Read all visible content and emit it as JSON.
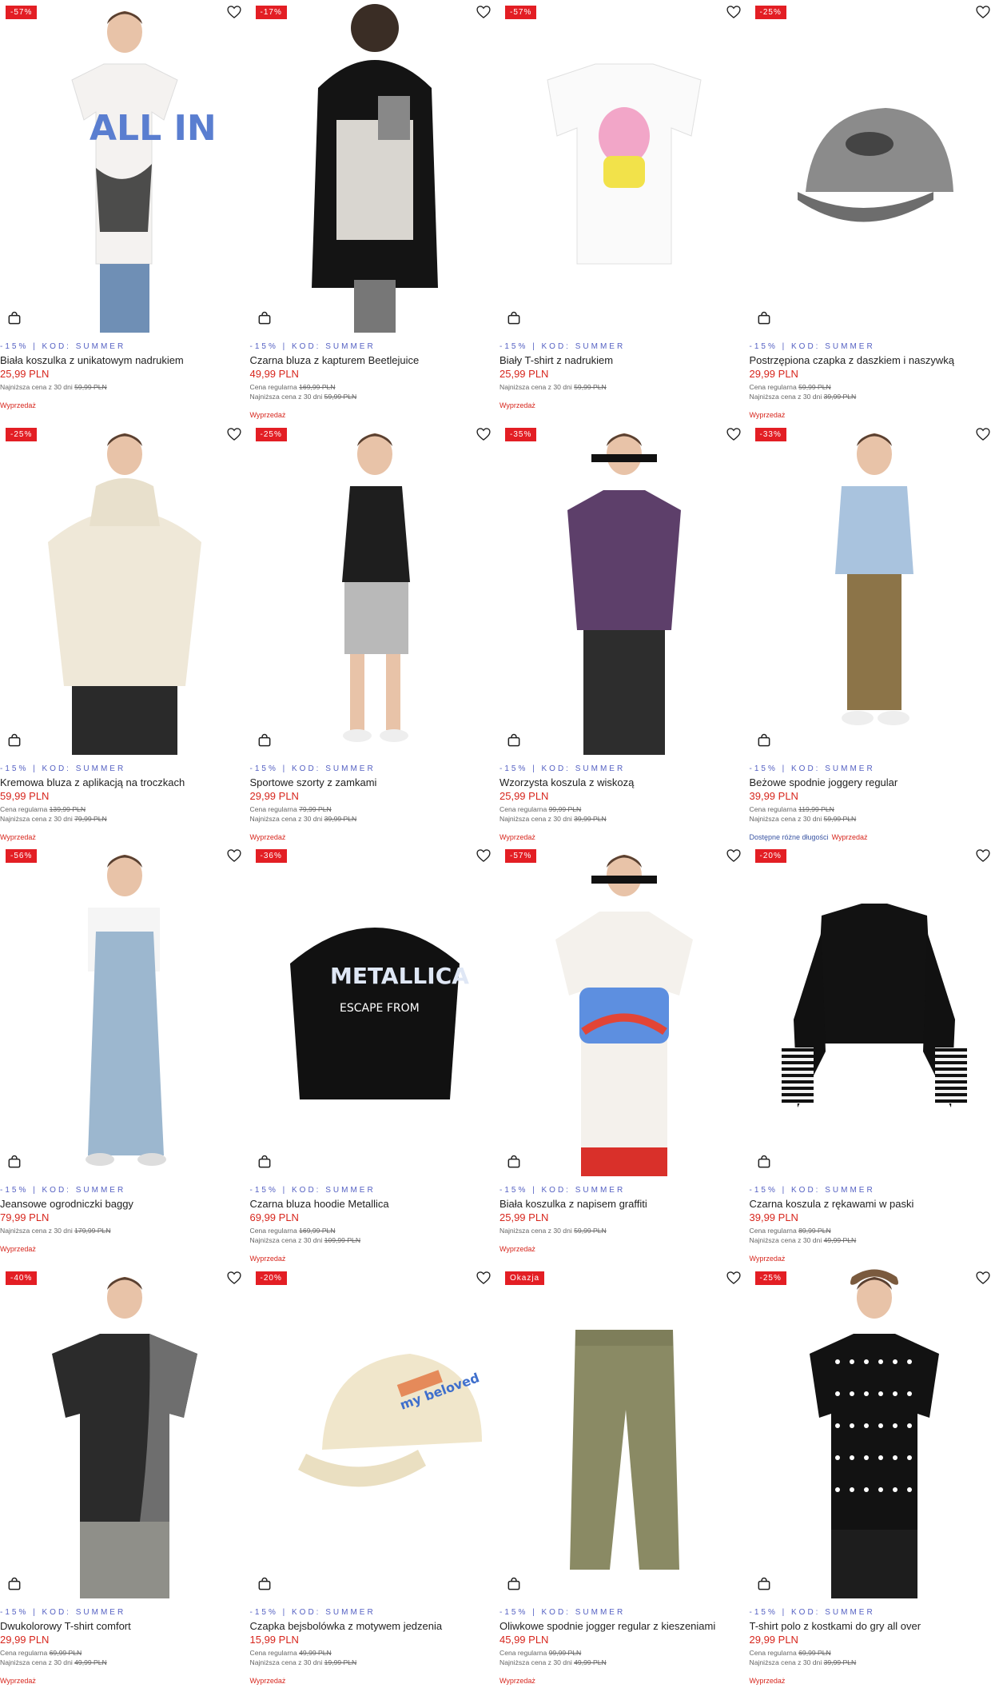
{
  "colors": {
    "badge": "#e31e24",
    "price": "#d7261d",
    "promo": "#5561c3"
  },
  "icons": {
    "wishlist": "heart-icon",
    "cart": "shopping-bag-icon"
  },
  "products": [
    {
      "badge": "-57%",
      "promo": "-15% | KOD: SUMMER",
      "name": "Biała koszulka z unikatowym nadrukiem",
      "price": "25,99 PLN",
      "regular_label": "",
      "regular_price": "",
      "lowest_label": "Najniższa cena z 30 dni",
      "lowest_price": "59,99 PLN",
      "flag": "Wyprzedaż",
      "sizes_note": "",
      "image": "white-oversized-tshirt"
    },
    {
      "badge": "-17%",
      "promo": "-15% | KOD: SUMMER",
      "name": "Czarna bluza z kapturem Beetlejuice",
      "price": "49,99 PLN",
      "regular_label": "Cena regularna",
      "regular_price": "169,99 PLN",
      "lowest_label": "Najniższa cena z 30 dni",
      "lowest_price": "59,99 PLN",
      "flag": "Wyprzedaż",
      "sizes_note": "",
      "image": "black-hoodie-back"
    },
    {
      "badge": "-57%",
      "promo": "-15% | KOD: SUMMER",
      "name": "Biały T-shirt z nadrukiem",
      "price": "25,99 PLN",
      "regular_label": "",
      "regular_price": "",
      "lowest_label": "Najniższa cena z 30 dni",
      "lowest_price": "59,99 PLN",
      "flag": "Wyprzedaż",
      "sizes_note": "",
      "image": "white-tshirt-flat"
    },
    {
      "badge": "-25%",
      "promo": "-15% | KOD: SUMMER",
      "name": "Postrzępiona czapka z daszkiem i naszywką",
      "price": "29,99 PLN",
      "regular_label": "Cena regularna",
      "regular_price": "59,99 PLN",
      "lowest_label": "Najniższa cena z 30 dni",
      "lowest_price": "39,99 PLN",
      "flag": "Wyprzedaż",
      "sizes_note": "",
      "image": "grey-cap"
    },
    {
      "badge": "-25%",
      "promo": "-15% | KOD: SUMMER",
      "name": "Kremowa bluza z aplikacją na troczkach",
      "price": "59,99 PLN",
      "regular_label": "Cena regularna",
      "regular_price": "139,99 PLN",
      "lowest_label": "Najniższa cena z 30 dni",
      "lowest_price": "79,99 PLN",
      "flag": "Wyprzedaż",
      "sizes_note": "",
      "image": "cream-hoodie"
    },
    {
      "badge": "-25%",
      "promo": "-15% | KOD: SUMMER",
      "name": "Sportowe szorty z zamkami",
      "price": "29,99 PLN",
      "regular_label": "Cena regularna",
      "regular_price": "79,99 PLN",
      "lowest_label": "Najniższa cena z 30 dni",
      "lowest_price": "39,99 PLN",
      "flag": "Wyprzedaż",
      "sizes_note": "",
      "image": "model-shorts"
    },
    {
      "badge": "-35%",
      "promo": "-15% | KOD: SUMMER",
      "name": "Wzorzysta koszula z wiskozą",
      "price": "25,99 PLN",
      "regular_label": "Cena regularna",
      "regular_price": "99,99 PLN",
      "lowest_label": "Najniższa cena z 30 dni",
      "lowest_price": "39,99 PLN",
      "flag": "Wyprzedaż",
      "sizes_note": "",
      "image": "purple-shirt"
    },
    {
      "badge": "-33%",
      "promo": "-15% | KOD: SUMMER",
      "name": "Beżowe spodnie joggery regular",
      "price": "39,99 PLN",
      "regular_label": "Cena regularna",
      "regular_price": "119,99 PLN",
      "lowest_label": "Najniższa cena z 30 dni",
      "lowest_price": "59,99 PLN",
      "flag": "Wyprzedaż",
      "sizes_note": "Dostępne różne długości",
      "image": "beige-joggers"
    },
    {
      "badge": "-56%",
      "promo": "-15% | KOD: SUMMER",
      "name": "Jeansowe ogrodniczki baggy",
      "price": "79,99 PLN",
      "regular_label": "",
      "regular_price": "",
      "lowest_label": "Najniższa cena z 30 dni",
      "lowest_price": "179,99 PLN",
      "flag": "Wyprzedaż",
      "sizes_note": "",
      "image": "denim-overalls"
    },
    {
      "badge": "-36%",
      "promo": "-15% | KOD: SUMMER",
      "name": "Czarna bluza hoodie Metallica",
      "price": "69,99 PLN",
      "regular_label": "Cena regularna",
      "regular_price": "169,99 PLN",
      "lowest_label": "Najniższa cena z 30 dni",
      "lowest_price": "109,99 PLN",
      "flag": "Wyprzedaż",
      "sizes_note": "",
      "image": "black-hoodie-flat"
    },
    {
      "badge": "-57%",
      "promo": "-15% | KOD: SUMMER",
      "name": "Biała koszulka z napisem graffiti",
      "price": "25,99 PLN",
      "regular_label": "",
      "regular_price": "",
      "lowest_label": "Najniższa cena z 30 dni",
      "lowest_price": "59,99 PLN",
      "flag": "Wyprzedaż",
      "sizes_note": "",
      "image": "graffiti-tshirt"
    },
    {
      "badge": "-20%",
      "promo": "-15% | KOD: SUMMER",
      "name": "Czarna koszula z rękawami w paski",
      "price": "39,99 PLN",
      "regular_label": "Cena regularna",
      "regular_price": "89,99 PLN",
      "lowest_label": "Najniższa cena z 30 dni",
      "lowest_price": "49,99 PLN",
      "flag": "Wyprzedaż",
      "sizes_note": "",
      "image": "black-shirt-stripes"
    },
    {
      "badge": "-40%",
      "promo": "-15% | KOD: SUMMER",
      "name": "Dwukolorowy T-shirt comfort",
      "price": "29,99 PLN",
      "regular_label": "Cena regularna",
      "regular_price": "69,99 PLN",
      "lowest_label": "Najniższa cena z 30 dni",
      "lowest_price": "49,99 PLN",
      "flag": "Wyprzedaż",
      "sizes_note": "",
      "image": "two-tone-tshirt"
    },
    {
      "badge": "-20%",
      "promo": "-15% | KOD: SUMMER",
      "name": "Czapka bejsbolówka z motywem jedzenia",
      "price": "15,99 PLN",
      "regular_label": "Cena regularna",
      "regular_price": "49,99 PLN",
      "lowest_label": "Najniższa cena z 30 dni",
      "lowest_price": "19,99 PLN",
      "flag": "Wyprzedaż",
      "sizes_note": "",
      "image": "cream-cap"
    },
    {
      "badge": "Okazja",
      "promo": "-15% | KOD: SUMMER",
      "name": "Oliwkowe spodnie jogger regular z kieszeniami",
      "price": "45,99 PLN",
      "regular_label": "Cena regularna",
      "regular_price": "99,99 PLN",
      "lowest_label": "Najniższa cena z 30 dni",
      "lowest_price": "49,99 PLN",
      "flag": "Wyprzedaż",
      "sizes_note": "",
      "image": "olive-joggers"
    },
    {
      "badge": "-25%",
      "promo": "-15% | KOD: SUMMER",
      "name": "T-shirt polo z kostkami do gry all over",
      "price": "29,99 PLN",
      "regular_label": "Cena regularna",
      "regular_price": "69,99 PLN",
      "lowest_label": "Najniższa cena z 30 dni",
      "lowest_price": "39,99 PLN",
      "flag": "Wyprzedaż",
      "sizes_note": "",
      "image": "dice-polo"
    }
  ]
}
